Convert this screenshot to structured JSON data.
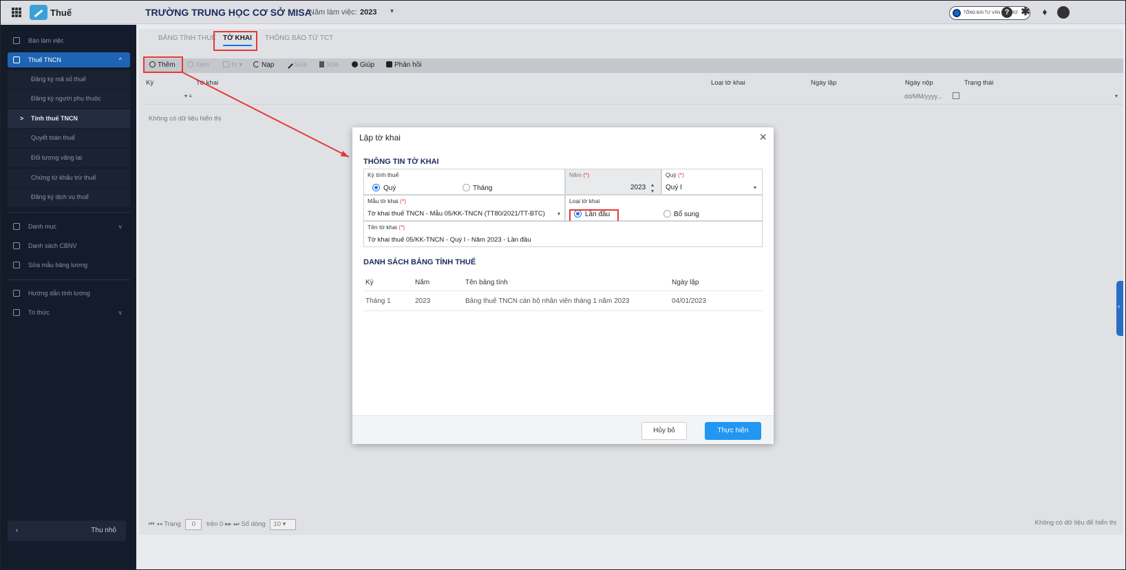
{
  "topbar": {
    "app_name": "Thuế",
    "school_name": "TRƯỜNG TRUNG HỌC CƠ SỞ MISA",
    "year_label": "Năm làm việc:",
    "year_value": "2023",
    "support_label": "TỔNG ĐÀI TƯ VẤN HỖ TRỢ"
  },
  "sidebar": {
    "items": [
      {
        "label": "Bàn làm việc"
      },
      {
        "label": "Thuế TNCN"
      },
      {
        "label": "Danh mục"
      },
      {
        "label": "Danh sách CBNV"
      },
      {
        "label": "Sửa mẫu bảng lương"
      },
      {
        "label": "Hướng dẫn tính lương"
      },
      {
        "label": "Tri thức"
      }
    ],
    "sub_items": [
      {
        "label": "Đăng ký mã số thuế"
      },
      {
        "label": "Đăng ký người phụ thuộc"
      },
      {
        "label": "Tính thuế TNCN"
      },
      {
        "label": "Quyết toán thuế"
      },
      {
        "label": "Đối tượng vãng lai"
      },
      {
        "label": "Chứng từ khấu trừ thuế"
      },
      {
        "label": "Đăng ký dịch vụ thuế"
      }
    ],
    "collapse_label": "Thu nhỏ"
  },
  "tabs": [
    {
      "label": "BẢNG TÍNH THUẾ"
    },
    {
      "label": "TỜ KHAI"
    },
    {
      "label": "THÔNG BÁO TỪ TCT"
    }
  ],
  "toolbar": {
    "add": "Thêm",
    "view": "Xem",
    "print": "In",
    "reload": "Nạp",
    "edit": "Sửa",
    "delete": "Xóa",
    "help": "Giúp",
    "feedback": "Phản hồi"
  },
  "grid": {
    "columns": [
      "Kỳ",
      "Tờ khai",
      "Loại tờ khai",
      "Ngày lập",
      "Ngày nộp",
      "Trạng thái"
    ],
    "date_placeholder": "dd/MM/yyyy...",
    "empty_text": "Không có dữ liệu hiển thị"
  },
  "pager": {
    "page_label": "Trang",
    "page_value": "0",
    "of_label": "trên 0",
    "rows_label": "Số dòng",
    "rows_value": "10",
    "right_text": "Không có dữ liệu để hiển thị"
  },
  "dialog": {
    "title": "Lập tờ khai",
    "section1": "THÔNG TIN TỜ KHAI",
    "period_label": "Kỳ tính thuế",
    "period_opt_quarter": "Quý",
    "period_opt_month": "Tháng",
    "year_label": "Năm",
    "year_value": "2023",
    "quarter_label": "Quý",
    "quarter_value": "Quý I",
    "template_label": "Mẫu tờ khai",
    "template_value": "Tờ khai thuế TNCN - Mẫu 05/KK-TNCN (TT80/2021/TT-BTC)",
    "type_label": "Loại tờ khai",
    "type_opt_first": "Lần đầu",
    "type_opt_extra": "Bổ sung",
    "name_label": "Tên tờ khai",
    "name_value": "Tờ khai thuế 05/KK-TNCN - Quý I - Năm 2023 - Lần đầu",
    "required_mark": "(*)",
    "section2": "DANH SÁCH BẢNG TÍNH THUẾ",
    "list_headers": [
      "Kỳ",
      "Năm",
      "Tên bảng tính",
      "Ngày lập"
    ],
    "list_rows": [
      {
        "period": "Tháng 1",
        "year": "2023",
        "name": "Bảng thuế TNCN cán bộ nhân viên tháng 1 năm 2023",
        "date": "04/01/2023"
      }
    ],
    "cancel_label": "Hủy bỏ",
    "ok_label": "Thực hiện"
  },
  "colors": {
    "accent": "#1a73e8",
    "highlight": "#e53935",
    "sidebar_bg": "#141c2b",
    "primary_button": "#2196f3"
  }
}
